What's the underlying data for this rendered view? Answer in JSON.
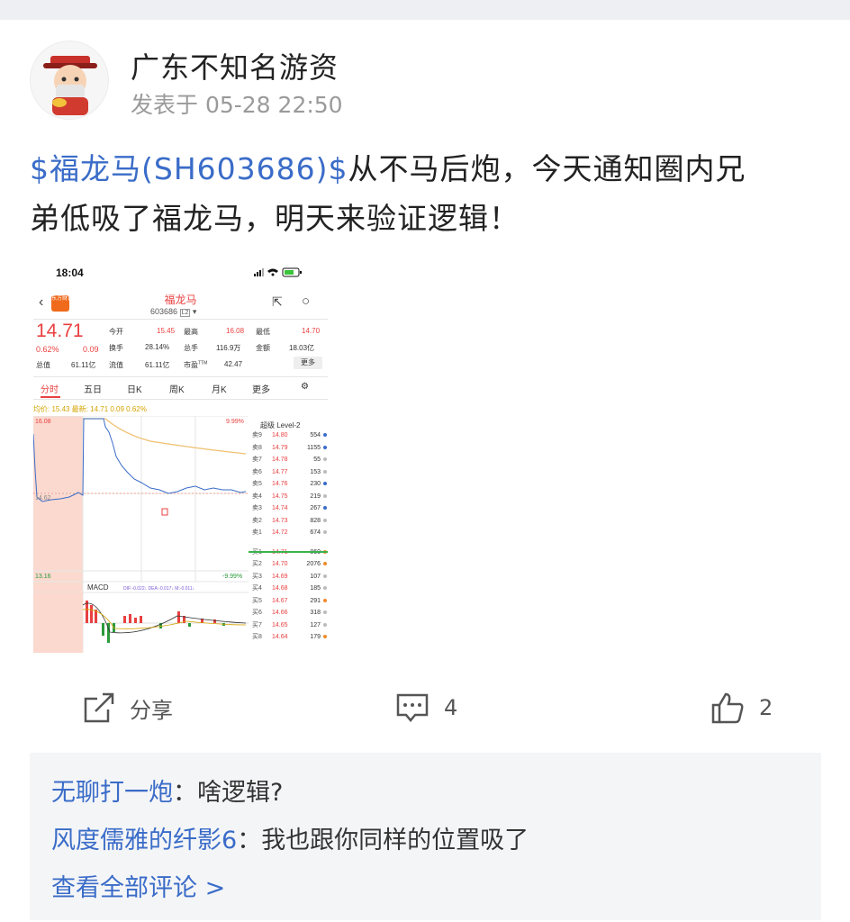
{
  "post": {
    "author": "广东不知名游资",
    "time": "发表于 05-28 22:50",
    "stock_link": "$福龙马(SH603686)$",
    "text_line1": "从不马后炮，今天通知圈内兄",
    "text_line2": "弟低吸了福龙马，明天来验证逻辑！"
  },
  "screenshot": {
    "status_time": "18:04",
    "stock_name": "福龙马",
    "stock_code": "603686",
    "code_badge": "L2",
    "logo_text": "东方财富",
    "price": "14.71",
    "change_pct": "0.62%",
    "change_amt": "0.09",
    "stats": {
      "open_label": "今开",
      "open": "15.45",
      "high_label": "最高",
      "high": "16.08",
      "low_label": "最低",
      "low": "14.70",
      "turnover_label": "换手",
      "turnover": "28.14%",
      "volume_label": "总手",
      "volume": "116.9万",
      "amount_label": "金额",
      "amount": "18.03亿",
      "mktcap_label": "总值",
      "mktcap": "61.11亿",
      "float_label": "流值",
      "float": "61.11亿",
      "pe_label": "市盈",
      "pe_sup": "TTM",
      "pe": "42.47",
      "more": "更多"
    },
    "tabs": [
      "分时",
      "五日",
      "日K",
      "周K",
      "月K",
      "更多",
      "⚙"
    ],
    "avg_line": "均价: 15.43  最新: 14.71  0.09  0.62%",
    "chart_top": "16.08",
    "chart_bottom": "13.16",
    "chart_mid": "14.62",
    "pct_top": "9.99%",
    "pct_bottom": "-9.99%",
    "macd_label": "MACD",
    "macd_vals": "DIF:-0.022↓  DEA:-0.017↓  M:-0.011↓",
    "ob_title": "超级 Level-2",
    "order_book": [
      {
        "label": "卖9",
        "price": "14.80",
        "vol": "554",
        "dot": "#3a6cc8"
      },
      {
        "label": "卖8",
        "price": "14.79",
        "vol": "1155",
        "dot": "#3a6cc8"
      },
      {
        "label": "卖7",
        "price": "14.78",
        "vol": "55",
        "dot": "#bbbbbb"
      },
      {
        "label": "卖6",
        "price": "14.77",
        "vol": "153",
        "dot": "#bbbbbb"
      },
      {
        "label": "卖5",
        "price": "14.76",
        "vol": "230",
        "dot": "#3a6cc8"
      },
      {
        "label": "卖4",
        "price": "14.75",
        "vol": "219",
        "dot": "#bbbbbb"
      },
      {
        "label": "卖3",
        "price": "14.74",
        "vol": "267",
        "dot": "#3a6cc8"
      },
      {
        "label": "卖2",
        "price": "14.73",
        "vol": "828",
        "dot": "#bbbbbb"
      },
      {
        "label": "卖1",
        "price": "14.72",
        "vol": "674",
        "dot": "#bbbbbb"
      },
      {
        "label": "买1",
        "price": "14.71",
        "vol": "860",
        "dot": "#f08a2a"
      },
      {
        "label": "买2",
        "price": "14.70",
        "vol": "2076",
        "dot": "#f08a2a"
      },
      {
        "label": "买3",
        "price": "14.69",
        "vol": "107",
        "dot": "#bbbbbb"
      },
      {
        "label": "买4",
        "price": "14.68",
        "vol": "185",
        "dot": "#bbbbbb"
      },
      {
        "label": "买5",
        "price": "14.67",
        "vol": "291",
        "dot": "#f08a2a"
      },
      {
        "label": "买6",
        "price": "14.66",
        "vol": "318",
        "dot": "#bbbbbb"
      },
      {
        "label": "买7",
        "price": "14.65",
        "vol": "127",
        "dot": "#bbbbbb"
      },
      {
        "label": "买8",
        "price": "14.64",
        "vol": "179",
        "dot": "#f08a2a"
      }
    ]
  },
  "actions": {
    "share_label": "分享",
    "comment_count": "4",
    "like_count": "2"
  },
  "comments": [
    {
      "user": "无聊打一炮",
      "sep": "：",
      "text": "啥逻辑?"
    },
    {
      "user": "风度儒雅的纤影6",
      "sep": "：",
      "text": "我也跟你同样的位置吸了"
    }
  ],
  "view_all": "查看全部评论 >",
  "colors": {
    "link": "#3a6cc8",
    "up": "#e94040",
    "down": "#2a9a3a"
  }
}
